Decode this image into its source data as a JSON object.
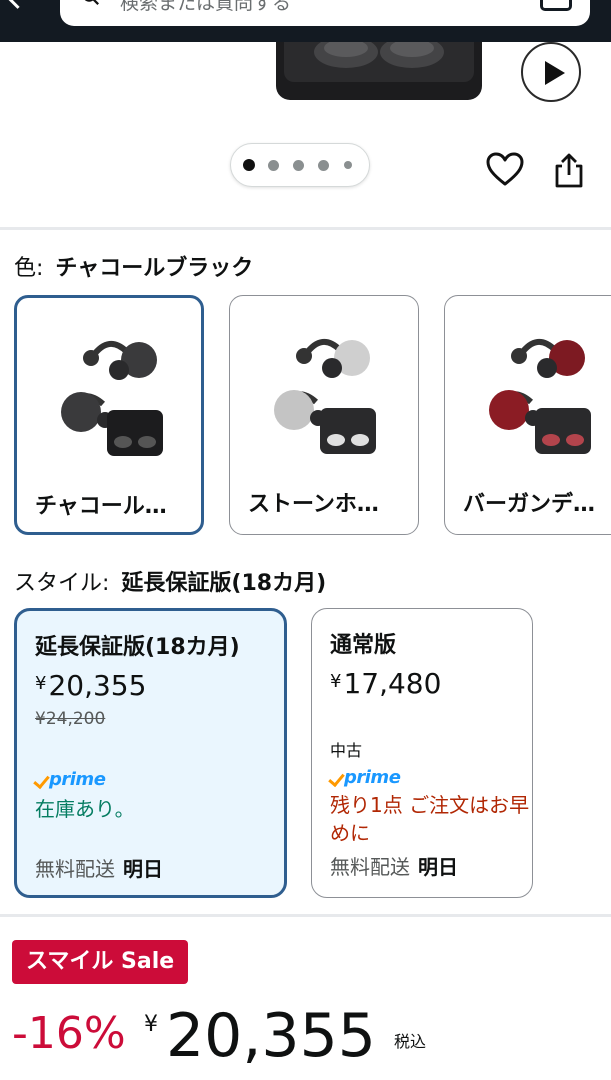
{
  "search": {
    "placeholder": "検索または質問する"
  },
  "image_indicator": {
    "total": 5,
    "active_index": 0
  },
  "color": {
    "label": "色:",
    "selected": "チャコールブラック",
    "options": [
      {
        "name": "チャコール…",
        "accent": "#3a3a3c"
      },
      {
        "name": "ストーンホ…",
        "accent": "#c9c9c9"
      },
      {
        "name": "バーガンデ…",
        "accent": "#8b1c24"
      }
    ]
  },
  "style": {
    "label": "スタイル:",
    "selected": "延長保証版(18カ月)",
    "options": [
      {
        "title": "延長保証版(18カ月)",
        "currency": "¥",
        "price": "20,355",
        "list_price": "¥24,200",
        "prime": "prime",
        "availability": "在庫あり。",
        "delivery_label": "無料配送",
        "delivery_day": "明日"
      },
      {
        "title": "通常版",
        "currency": "¥",
        "price": "17,480",
        "condition": "中古",
        "prime": "prime",
        "availability": "残り1点 ご注文はお早めに",
        "delivery_label": "無料配送",
        "delivery_day": "明日"
      }
    ]
  },
  "deal": {
    "badge": "スマイル Sale",
    "discount": "-16%",
    "currency": "¥",
    "price": "20,355",
    "tax": "税込"
  },
  "colors": {
    "header": "#131a22",
    "selected_border": "#2f5e8f",
    "deal_red": "#cc0c39",
    "in_stock": "#067d62",
    "low_stock": "#b12704",
    "prime_blue": "#1a98ff"
  }
}
